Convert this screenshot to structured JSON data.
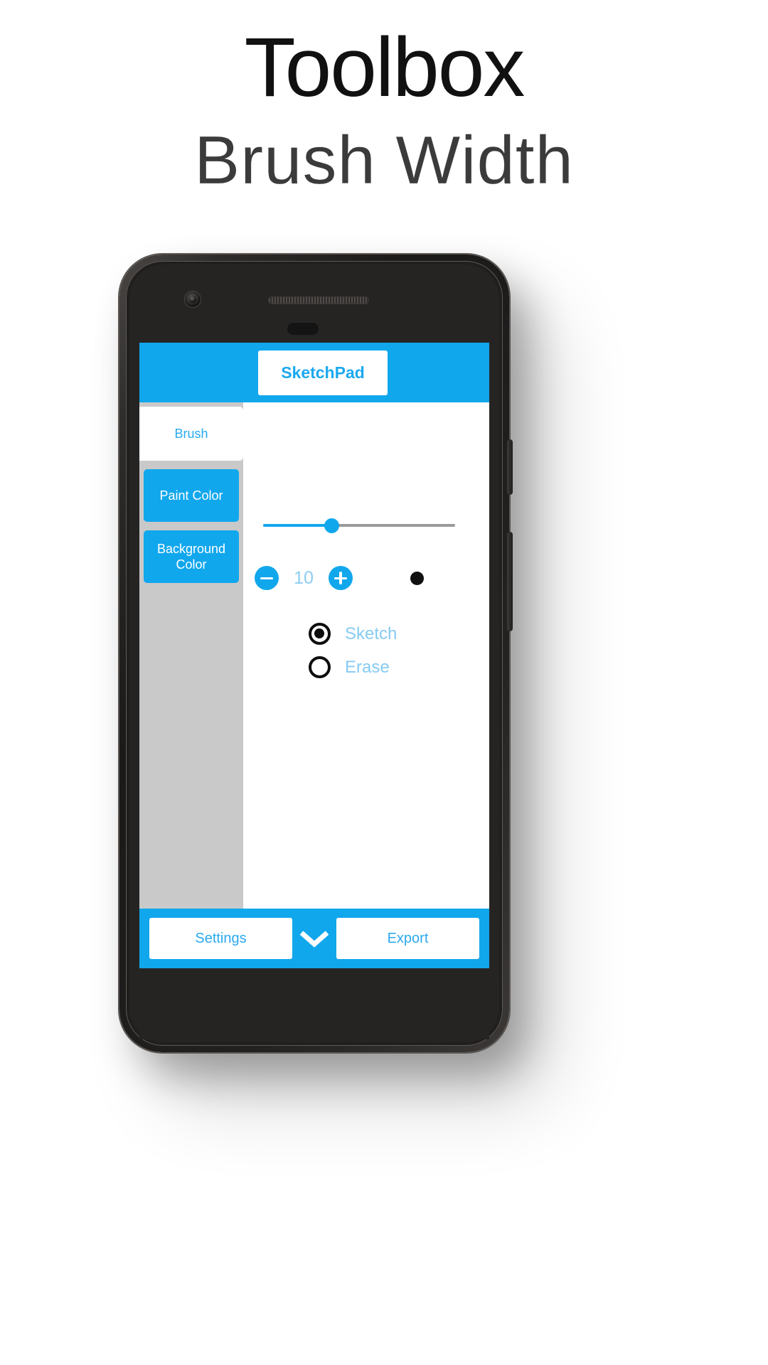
{
  "promo": {
    "title": "Toolbox",
    "subtitle": "Brush Width"
  },
  "app": {
    "title": "SketchPad",
    "header_color": "#11a7ed",
    "accent_color": "#11a7ed",
    "sidebar": {
      "background_color": "#c9c9c9",
      "tabs": [
        {
          "label": "Brush",
          "state": "active"
        },
        {
          "label": "Paint Color",
          "state": "inactive"
        },
        {
          "label": "Background Color",
          "state": "inactive"
        }
      ]
    },
    "brush_panel": {
      "slider": {
        "value": 10,
        "min": 1,
        "max": 30,
        "fill_percent": 36
      },
      "stepper": {
        "decrement_label": "−",
        "increment_label": "+",
        "value": "10"
      },
      "preview": {
        "shape": "dot",
        "color": "#111111"
      },
      "modes": [
        {
          "label": "Sketch",
          "selected": true
        },
        {
          "label": "Erase",
          "selected": false
        }
      ]
    },
    "footer": {
      "settings_label": "Settings",
      "export_label": "Export",
      "expand_icon": "chevron-down"
    }
  }
}
